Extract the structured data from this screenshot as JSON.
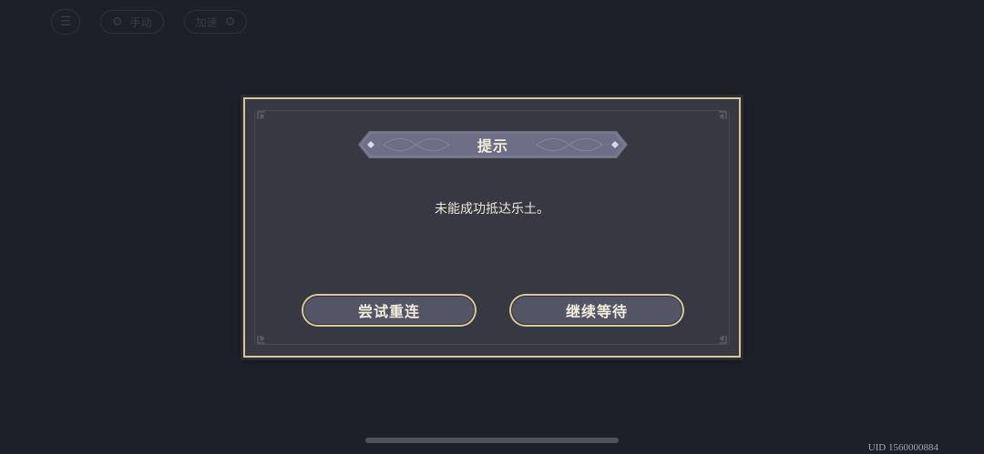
{
  "hud": {
    "menu_icon": "menu-icon",
    "pill1_label": "手动",
    "pill2_label": "加速"
  },
  "dialog": {
    "title": "提示",
    "message": "未能成功抵达乐土。",
    "retry_label": "尝试重连",
    "wait_label": "继续等待"
  },
  "footer": {
    "uid": "UID 1560000884"
  },
  "colors": {
    "background": "#1d2029",
    "dialog_fill": "#383843",
    "gold_border": "#d9c99a",
    "banner_fill": "#6e6e86",
    "button_fill": "#535566"
  }
}
